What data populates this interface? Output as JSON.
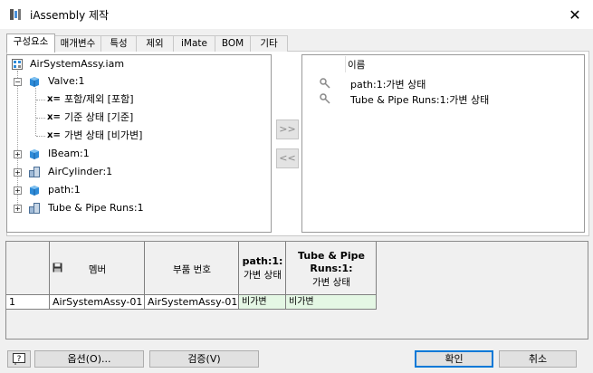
{
  "window": {
    "title": "iAssembly 제작",
    "close_label": "✕"
  },
  "tabs": [
    {
      "label": "구성요소",
      "active": true
    },
    {
      "label": "매개변수"
    },
    {
      "label": "특성"
    },
    {
      "label": "제외"
    },
    {
      "label": "iMate"
    },
    {
      "label": "BOM"
    },
    {
      "label": "기타"
    }
  ],
  "tree": {
    "root": "AirSystemAssy.iam",
    "items": [
      {
        "label": "Valve:1",
        "expanded": true,
        "icon": "part-cube-icon"
      },
      {
        "label": "포함/제외 [포함]",
        "icon": "x-equals-icon"
      },
      {
        "label": "기준 상태 [기준]",
        "icon": "x-equals-icon"
      },
      {
        "label": "가변 상태 [비가변]",
        "icon": "x-equals-icon"
      },
      {
        "label": "IBeam:1",
        "icon": "part-cube-icon"
      },
      {
        "label": "AirCylinder:1",
        "icon": "assembly-cube-icon"
      },
      {
        "label": "path:1",
        "icon": "part-cube-icon"
      },
      {
        "label": "Tube & Pipe Runs:1",
        "icon": "assembly-cube-icon"
      }
    ]
  },
  "move_buttons": {
    "add": ">>",
    "remove": "<<"
  },
  "right_list": {
    "header": "이름",
    "items": [
      "path:1:가변 상태",
      "Tube & Pipe Runs:1:가변 상태"
    ]
  },
  "table": {
    "headers": {
      "member": "멤버",
      "part_number": "부품 번호",
      "col3_line1": "path:1:",
      "col3_line2": "가변 상태",
      "col4_line1": "Tube & Pipe",
      "col4_line2": "Runs:1:",
      "col4_line3": "가변 상태"
    },
    "rows": [
      {
        "index": "1",
        "member": "AirSystemAssy-01",
        "part_number": "AirSystemAssy-01",
        "col3": "비가변",
        "col4": "비가변"
      }
    ]
  },
  "buttons": {
    "options": "옵션(O)...",
    "verify": "검증(V)",
    "ok": "확인",
    "cancel": "취소"
  },
  "colors": {
    "accent": "#0078d7",
    "cube_blue": "#2e8bd8",
    "green_cell": "#e4f7e4"
  }
}
